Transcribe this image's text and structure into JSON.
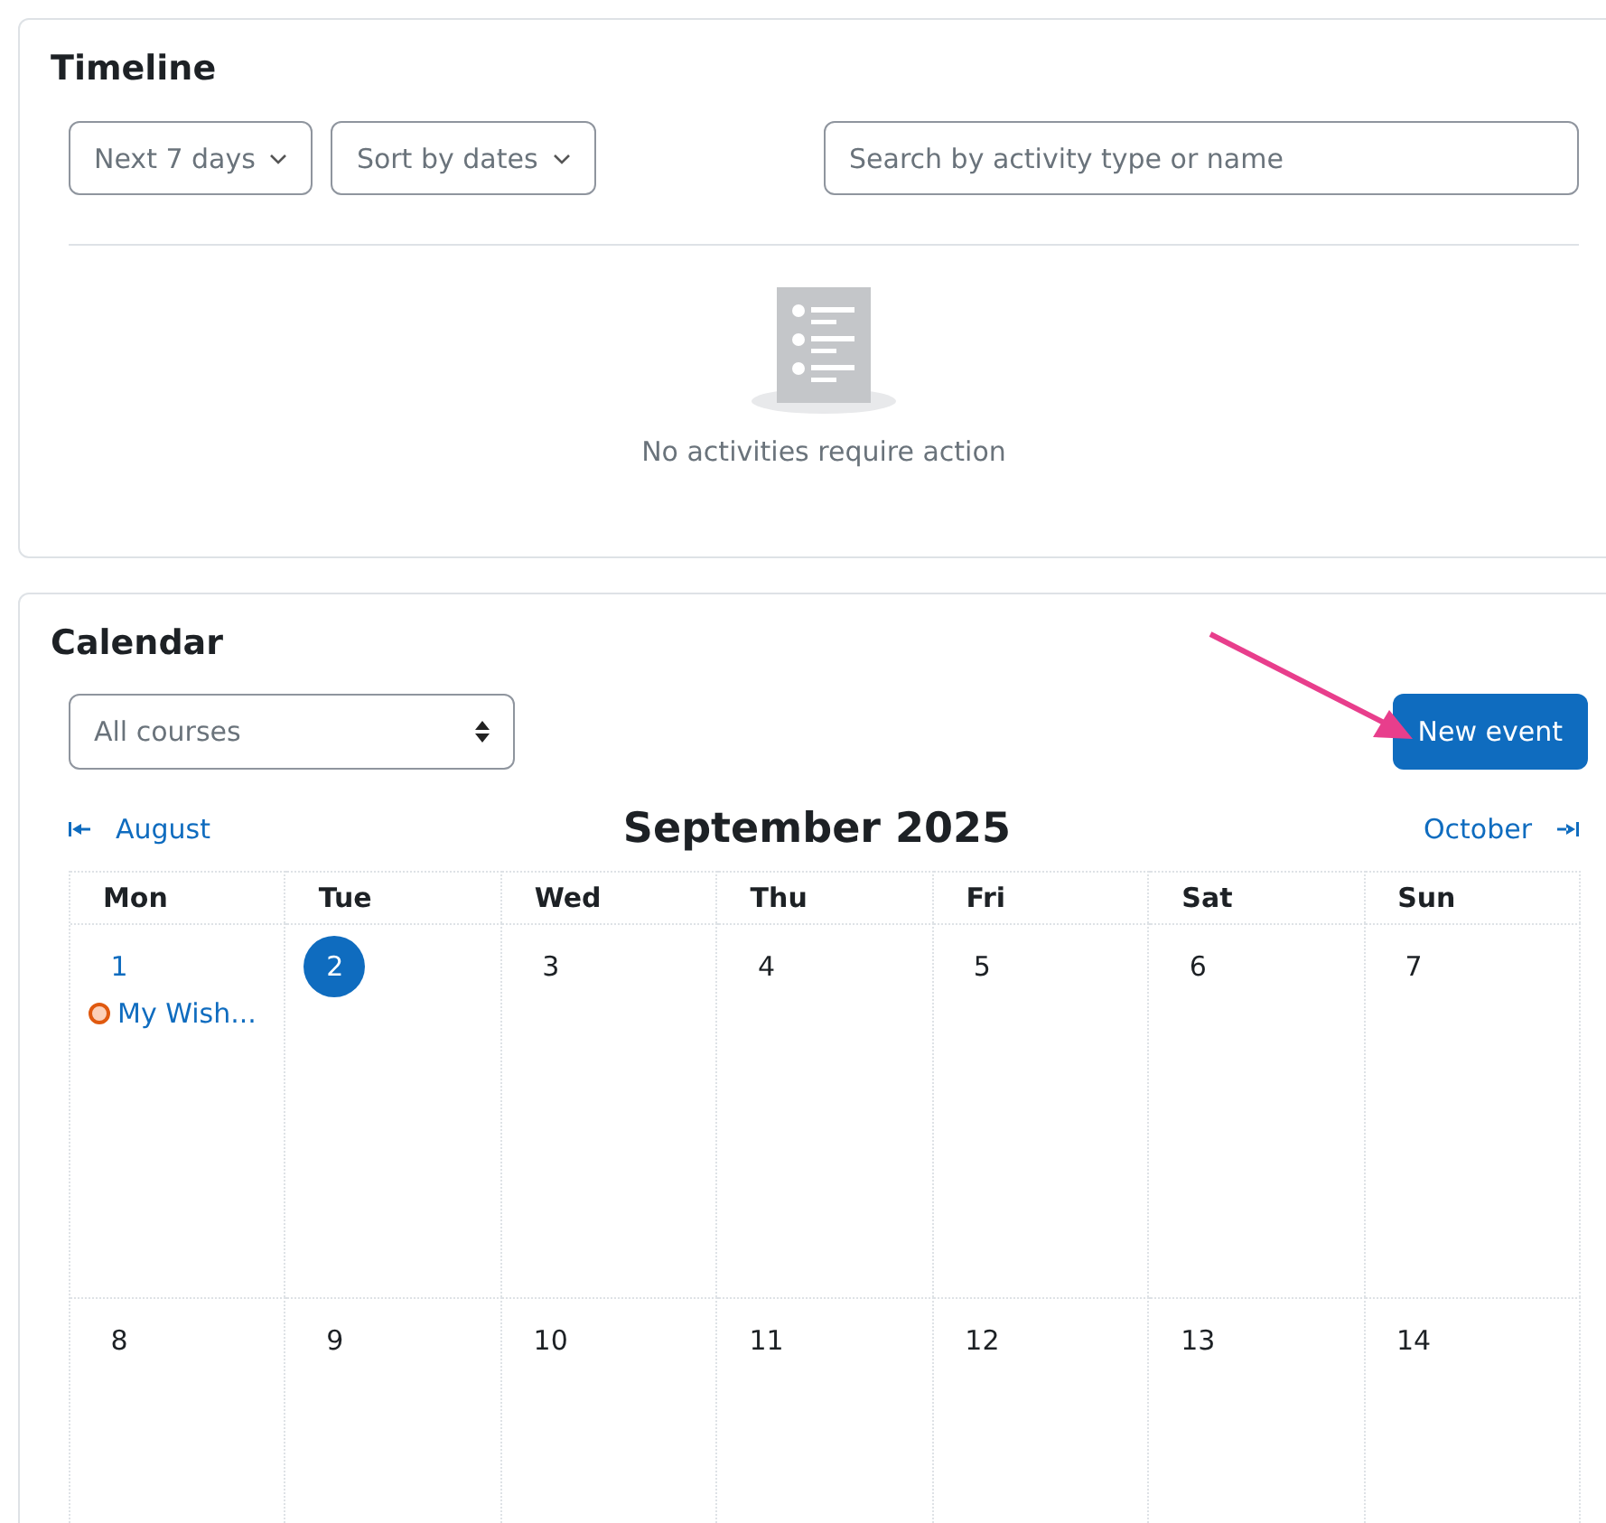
{
  "timeline": {
    "title": "Timeline",
    "filters": [
      {
        "label": "Next 7 days"
      },
      {
        "label": "Sort by dates"
      }
    ],
    "search": {
      "placeholder": "Search by activity type or name"
    },
    "empty_message": "No activities require action"
  },
  "calendar": {
    "title": "Calendar",
    "course_select": "All courses",
    "new_event_button": "New event",
    "prev_month": "August",
    "next_month": "October",
    "month_title": "September 2025",
    "weekdays": [
      "Mon",
      "Tue",
      "Wed",
      "Thu",
      "Fri",
      "Sat",
      "Sun"
    ],
    "weeks": [
      [
        {
          "day": "1",
          "today": false,
          "events": [
            {
              "title": "My Wish...",
              "color": "#e0590f"
            }
          ]
        },
        {
          "day": "2",
          "today": true
        },
        {
          "day": "3",
          "today": false
        },
        {
          "day": "4",
          "today": false
        },
        {
          "day": "5",
          "today": false
        },
        {
          "day": "6",
          "today": false
        },
        {
          "day": "7",
          "today": false
        }
      ],
      [
        {
          "day": "8",
          "today": false
        },
        {
          "day": "9",
          "today": false
        },
        {
          "day": "10",
          "today": false
        },
        {
          "day": "11",
          "today": false
        },
        {
          "day": "12",
          "today": false
        },
        {
          "day": "13",
          "today": false
        },
        {
          "day": "14",
          "today": false
        }
      ]
    ]
  }
}
